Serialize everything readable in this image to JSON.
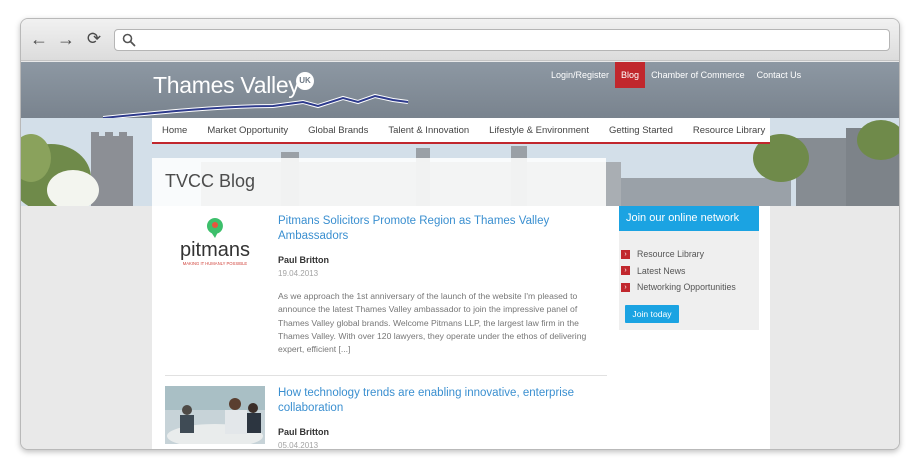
{
  "browser": {
    "back_glyph": "←",
    "forward_glyph": "→",
    "reload_glyph": "⟳",
    "address_value": ""
  },
  "site": {
    "logo_text": "Thames Valley",
    "logo_badge": "UK"
  },
  "top_links": [
    {
      "label": "Login/Register",
      "active": false
    },
    {
      "label": "Blog",
      "active": true
    },
    {
      "label": "Chamber of Commerce",
      "active": false
    },
    {
      "label": "Contact Us",
      "active": false
    }
  ],
  "main_nav": [
    {
      "label": "Home"
    },
    {
      "label": "Market Opportunity"
    },
    {
      "label": "Global Brands"
    },
    {
      "label": "Talent & Innovation"
    },
    {
      "label": "Lifestyle & Environment"
    },
    {
      "label": "Getting Started"
    },
    {
      "label": "Resource Library"
    }
  ],
  "page_title": "TVCC Blog",
  "posts": [
    {
      "title": "Pitmans Solicitors Promote Region as Thames Valley Ambassadors",
      "author": "Paul Britton",
      "date": "19.04.2013",
      "excerpt": "As we approach the 1st anniversary of the launch of the website I'm pleased to announce the latest Thames Valley ambassador to join the impressive panel of Thames Valley global brands. Welcome Pitmans LLP, the largest law firm in the Thames Valley. With over 120 lawyers, they operate under the ethos of delivering expert, efficient [...]",
      "thumb_brand": "pitmans",
      "thumb_tagline": "MAKING IT HUMANLY POSSIBLE"
    },
    {
      "title": "How technology trends are enabling innovative, enterprise collaboration",
      "author": "Paul Britton",
      "date": "05.04.2013"
    }
  ],
  "sidebar": {
    "heading": "Join our online network",
    "items": [
      {
        "label": "Resource Library"
      },
      {
        "label": "Latest News"
      },
      {
        "label": "Networking Opportunities"
      }
    ],
    "button_label": "Join today"
  },
  "colors": {
    "accent_red": "#c1272d",
    "accent_blue": "#1ba3e2",
    "link_blue": "#3a8fd0",
    "header_grey": "#7f8a95"
  }
}
